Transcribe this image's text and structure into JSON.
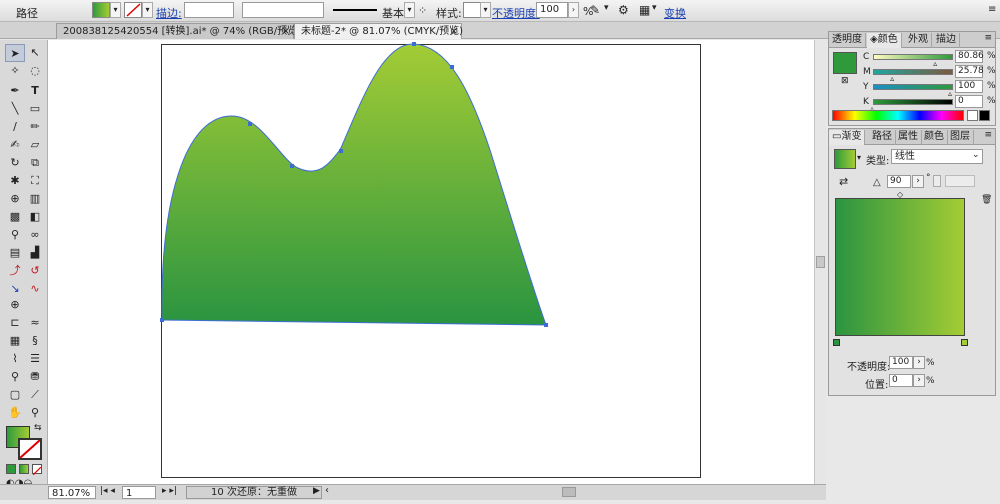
{
  "control_bar": {
    "object_type": "路径",
    "stroke_label": "描边:",
    "stroke_profile": "基本",
    "style_label": "样式:",
    "opacity_label": "不透明度:",
    "opacity_value": "100",
    "opacity_unit": "%",
    "transform_label": "变换"
  },
  "doc_tabs": [
    {
      "label": "200838125420554 [转换].ai* @ 74% (RGB/预览)",
      "active": false
    },
    {
      "label": "未标题-2* @ 81.07% (CMYK/预览)",
      "active": true
    }
  ],
  "close_glyph": "×",
  "color_panel": {
    "tabs": [
      "透明度",
      "颜色",
      "外观",
      "描边"
    ],
    "active_tab": "颜色",
    "channels": [
      {
        "name": "C",
        "value": "80.86",
        "fraction": 0.8086
      },
      {
        "name": "M",
        "value": "25.78",
        "fraction": 0.2578
      },
      {
        "name": "Y",
        "value": "100",
        "fraction": 1.0
      },
      {
        "name": "K",
        "value": "0",
        "fraction": 0.0
      }
    ],
    "unit": "%",
    "swatch_color": "#2e9a3c"
  },
  "gradient_panel": {
    "tabs": [
      "渐变",
      "路径",
      "属性",
      "颜色",
      "图层"
    ],
    "active_tab": "渐变",
    "type_label": "类型:",
    "type_value": "线性",
    "angle_value": "90",
    "degree_unit": "°",
    "opacity_label": "不透明度:",
    "opacity_value": "100",
    "position_label": "位置:",
    "position_value": "0",
    "unit": "%",
    "start_color": "#2b9440",
    "end_color": "#a4cc34"
  },
  "status_bar": {
    "zoom": "81.07%",
    "artboard": "1",
    "status_text": "10 次还原：无重做"
  },
  "colors": {
    "fill_top": "#a3cc35",
    "fill_bottom": "#2a9440",
    "path_stroke": "#3d6dd4"
  }
}
